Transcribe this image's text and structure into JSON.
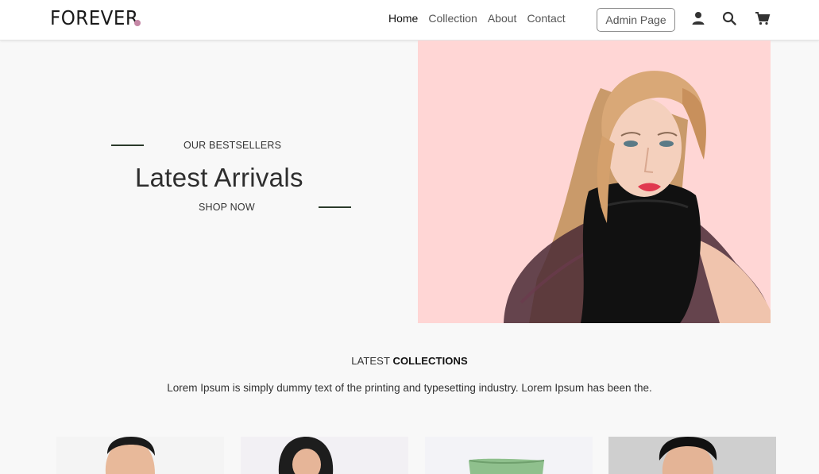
{
  "brand": {
    "name": "FOREVER",
    "dot_color": "#c586a5"
  },
  "nav": {
    "links": [
      {
        "label": "Home",
        "active": true
      },
      {
        "label": "Collection",
        "active": false
      },
      {
        "label": "About",
        "active": false
      },
      {
        "label": "Contact",
        "active": false
      }
    ],
    "admin_button": "Admin Page",
    "icons": [
      "user-icon",
      "search-icon",
      "cart-icon"
    ]
  },
  "hero": {
    "eyebrow": "OUR BESTSELLERS",
    "title": "Latest Arrivals",
    "cta": "SHOP NOW",
    "image_bg": "#ffd6d5"
  },
  "collections": {
    "title_light": "LATEST",
    "title_bold": "COLLECTIONS",
    "description": "Lorem Ipsum is simply dummy text of the printing and typesetting industry. Lorem Ipsum has been the."
  },
  "products": [
    {
      "name": "product-card-1",
      "bg": "#f4f4f4"
    },
    {
      "name": "product-card-2",
      "bg": "#f2f0f4"
    },
    {
      "name": "product-card-3",
      "bg": "#f3f3f7"
    },
    {
      "name": "product-card-4",
      "bg": "#cfcfcf"
    }
  ]
}
